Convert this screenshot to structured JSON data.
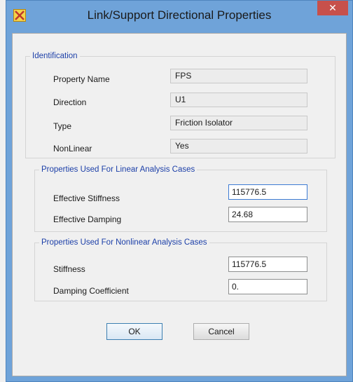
{
  "window": {
    "title": "Link/Support Directional Properties",
    "close_label": "✕",
    "icon": "app-logo-icon"
  },
  "identification": {
    "legend": "Identification",
    "rows": [
      {
        "label": "Property Name",
        "value": "FPS"
      },
      {
        "label": "Direction",
        "value": "U1"
      },
      {
        "label": "Type",
        "value": "Friction Isolator"
      },
      {
        "label": "NonLinear",
        "value": "Yes"
      }
    ]
  },
  "linear": {
    "legend": "Properties Used For Linear Analysis Cases",
    "rows": [
      {
        "label": "Effective Stiffness",
        "value": "115776.5"
      },
      {
        "label": "Effective Damping",
        "value": "24.68"
      }
    ]
  },
  "nonlinear": {
    "legend": "Properties Used For Nonlinear Analysis Cases",
    "rows": [
      {
        "label": "Stiffness",
        "value": "115776.5"
      },
      {
        "label": "Damping Coefficient",
        "value": "0."
      }
    ]
  },
  "buttons": {
    "ok": "OK",
    "cancel": "Cancel"
  },
  "colors": {
    "accent": "#1c3fa8",
    "frame": "#6fa3d9",
    "close": "#c7504b"
  }
}
